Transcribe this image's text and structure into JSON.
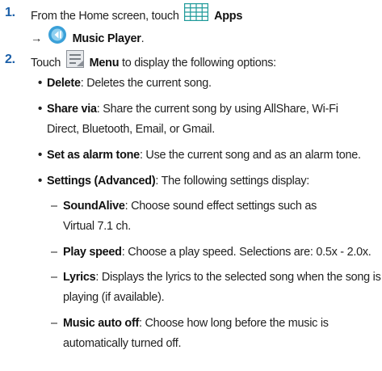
{
  "steps": [
    {
      "number": "1.",
      "line1_prefix": "From the Home screen, touch",
      "line1_bold": "Apps",
      "line1_icon": "apps-grid-icon",
      "line2_arrow": "→",
      "line2_bold": "Music Player",
      "line2_suffix": ".",
      "line2_icon": "music-player-icon"
    },
    {
      "number": "2.",
      "prefix": "Touch",
      "icon": "menu-icon",
      "bold": "Menu",
      "suffix": " to display the following options:"
    }
  ],
  "options": [
    {
      "term": "Delete",
      "desc": ": Deletes the current song."
    },
    {
      "term": "Share via",
      "desc_line1": ": Share the current song by using AllShare, Wi-Fi",
      "desc_line2": "Direct, Bluetooth, Email, or Gmail."
    },
    {
      "term": "Set as alarm tone",
      "desc": ": Use the current song and as an alarm tone."
    },
    {
      "term": "Settings (Advanced)",
      "desc": ": The following settings display:"
    }
  ],
  "sub_options": [
    {
      "term": "SoundAlive",
      "desc_line1": ": Choose sound effect settings such as",
      "desc_line2": "Virtual 7.1 ch."
    },
    {
      "term": "Play speed",
      "desc": ": Choose a play speed. Selections are: 0.5x - 2.0x."
    },
    {
      "term": "Lyrics",
      "desc_line1": ": Displays the lyrics to the selected song when the song is",
      "desc_line2": "playing (if available)."
    },
    {
      "term": "Music auto off",
      "desc_line1": ": Choose how long before the music is",
      "desc_line2": "automatically turned off."
    }
  ],
  "bullet_char": "•",
  "dash_char": "–",
  "colors": {
    "step_number": "#1b5fa8",
    "apps_icon": "#1e9a9a",
    "music_icon": "#3aa0d8",
    "menu_icon": "#8a8f96"
  }
}
